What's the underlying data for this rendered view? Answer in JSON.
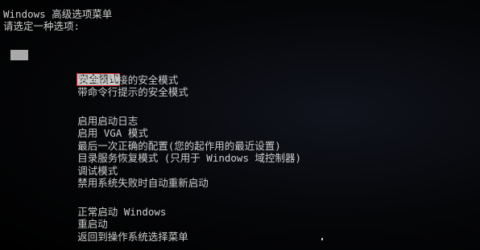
{
  "header": {
    "title": "Windows 高级选项菜单",
    "prompt": "请选定一种选项:"
  },
  "menu": {
    "group1": [
      "安全模式",
      "带网络连接的安全模式",
      "带命令行提示的安全模式"
    ],
    "group2": [
      "启用启动日志",
      "启用 VGA 模式",
      "最后一次正确的配置(您的起作用的最近设置)",
      "目录服务恢复模式 (只用于 Windows 域控制器)",
      "调试模式",
      "禁用系统失败时自动重新启动"
    ],
    "group3": [
      "正常启动 Windows",
      "重启动",
      "返回到操作系统选择菜单"
    ],
    "selected_item": "安全模式"
  },
  "colors": {
    "background": "#000000",
    "text": "#cfcfcf",
    "highlight_background": "#c4c4c4",
    "highlight_outline": "#d8262b"
  }
}
